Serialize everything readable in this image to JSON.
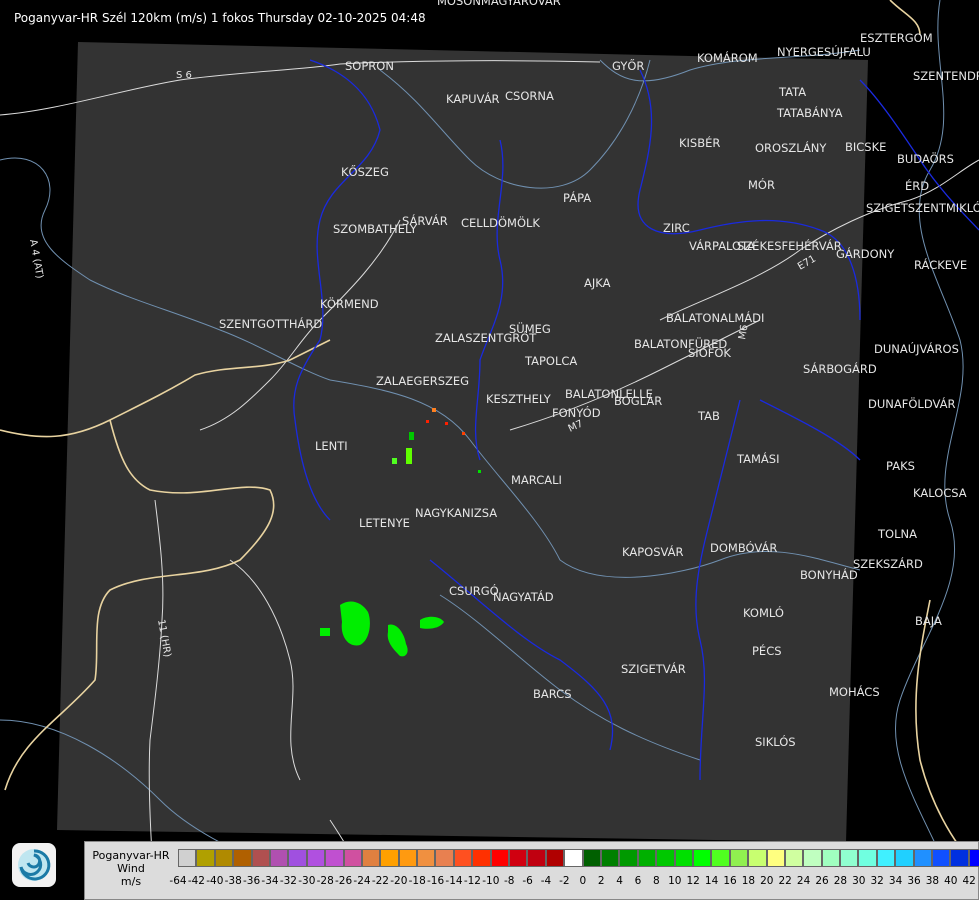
{
  "header": {
    "title": "Poganyvar-HR Szél 120km (m/s) 1 fokos Thursday 02-10-2025 04:48"
  },
  "map": {
    "cities": [
      "MOSONMAGYARÓVÁR",
      "SOPRON",
      "KAPUVÁR",
      "CSORNA",
      "GYŐR",
      "KOMÁROM",
      "ESZTERGOM",
      "NYERGESÚJFALU",
      "SZENTENDRE",
      "TATA",
      "TATABÁNYA",
      "KŐSZEG",
      "KISBÉR",
      "OROSZLÁNY",
      "BICSKE",
      "BUDAÖRS",
      "MÓR",
      "ÉRD",
      "SZIGETSZENTMIKLÓS",
      "SZOMBATHELY",
      "SÁRVÁR",
      "CELLDÖMÖLK",
      "PÁPA",
      "ZIRC",
      "VÁRPALOTA",
      "SZÉKESFEHÉRVÁR",
      "GÁRDONY",
      "RÁCKEVE",
      "AJKA",
      "KÖRMEND",
      "SZENTGOTTHÁRD",
      "BALATONALMÁDI",
      "ZALASZENTGRÓT",
      "SÜMEG",
      "BALATONFÜRED",
      "SIÓFOK",
      "DUNAÚJVÁROS",
      "TAPOLCA",
      "ZALAEGERSZEG",
      "SÁRBOGÁRD",
      "KESZTHELY",
      "BALATONLELLE",
      "FONYÓD",
      "BOGLÁR",
      "DUNAFÖLDVÁR",
      "TAB",
      "LENTI",
      "TAMÁSI",
      "PAKS",
      "MARCALI",
      "KALOCSA",
      "LETENYE",
      "NAGYKANIZSA",
      "TOLNA",
      "KAPOSVÁR",
      "DOMBÓVÁR",
      "SZEKSZÁRD",
      "BONYHÁD",
      "CSURGÓ",
      "NAGYATÁD",
      "KOMLÓ",
      "BAJA",
      "PÉCS",
      "SZIGETVÁR",
      "MOHÁCS",
      "BARCS",
      "SIKLÓS"
    ],
    "roads": [
      "S 6",
      "A 4 (AT)",
      "E71",
      "M7",
      "M6",
      "11 (HR)",
      "E 71"
    ]
  },
  "legend": {
    "name_lines": [
      "Poganyvar-HR",
      "Wind",
      "m/s"
    ],
    "colors": [
      "#d0d0d0",
      "#b0a000",
      "#b08a00",
      "#b06000",
      "#b05050",
      "#b050b0",
      "#a050e0",
      "#b050e0",
      "#c050d0",
      "#d050a0",
      "#e08040",
      "#ffa000",
      "#ff9a10",
      "#f09040",
      "#e88050",
      "#ff5020",
      "#ff3000",
      "#ff0000",
      "#d00010",
      "#c00010",
      "#b00000",
      "#ffffff",
      "#006000",
      "#008000",
      "#009a00",
      "#00b000",
      "#00c800",
      "#00e000",
      "#00ff00",
      "#50ff20",
      "#90f050",
      "#c8ff70",
      "#ffff80",
      "#d0ffa0",
      "#c0ffc0",
      "#a0ffc0",
      "#90ffd0",
      "#70ffe0",
      "#40f0ff",
      "#20d0ff",
      "#2090ff",
      "#1050ff",
      "#0030e0",
      "#0000ff"
    ],
    "ticks": [
      "-64",
      "-42",
      "-40",
      "-38",
      "-36",
      "-34",
      "-32",
      "-30",
      "-28",
      "-26",
      "-24",
      "-22",
      "-20",
      "-18",
      "-16",
      "-14",
      "-12",
      "-10",
      "-8",
      "-6",
      "-4",
      "-2",
      "0",
      "2",
      "4",
      "6",
      "8",
      "10",
      "12",
      "14",
      "16",
      "18",
      "20",
      "22",
      "24",
      "26",
      "28",
      "30",
      "32",
      "34",
      "36",
      "38",
      "40",
      "42"
    ]
  },
  "logo": {
    "icon": "radar-logo-icon"
  }
}
